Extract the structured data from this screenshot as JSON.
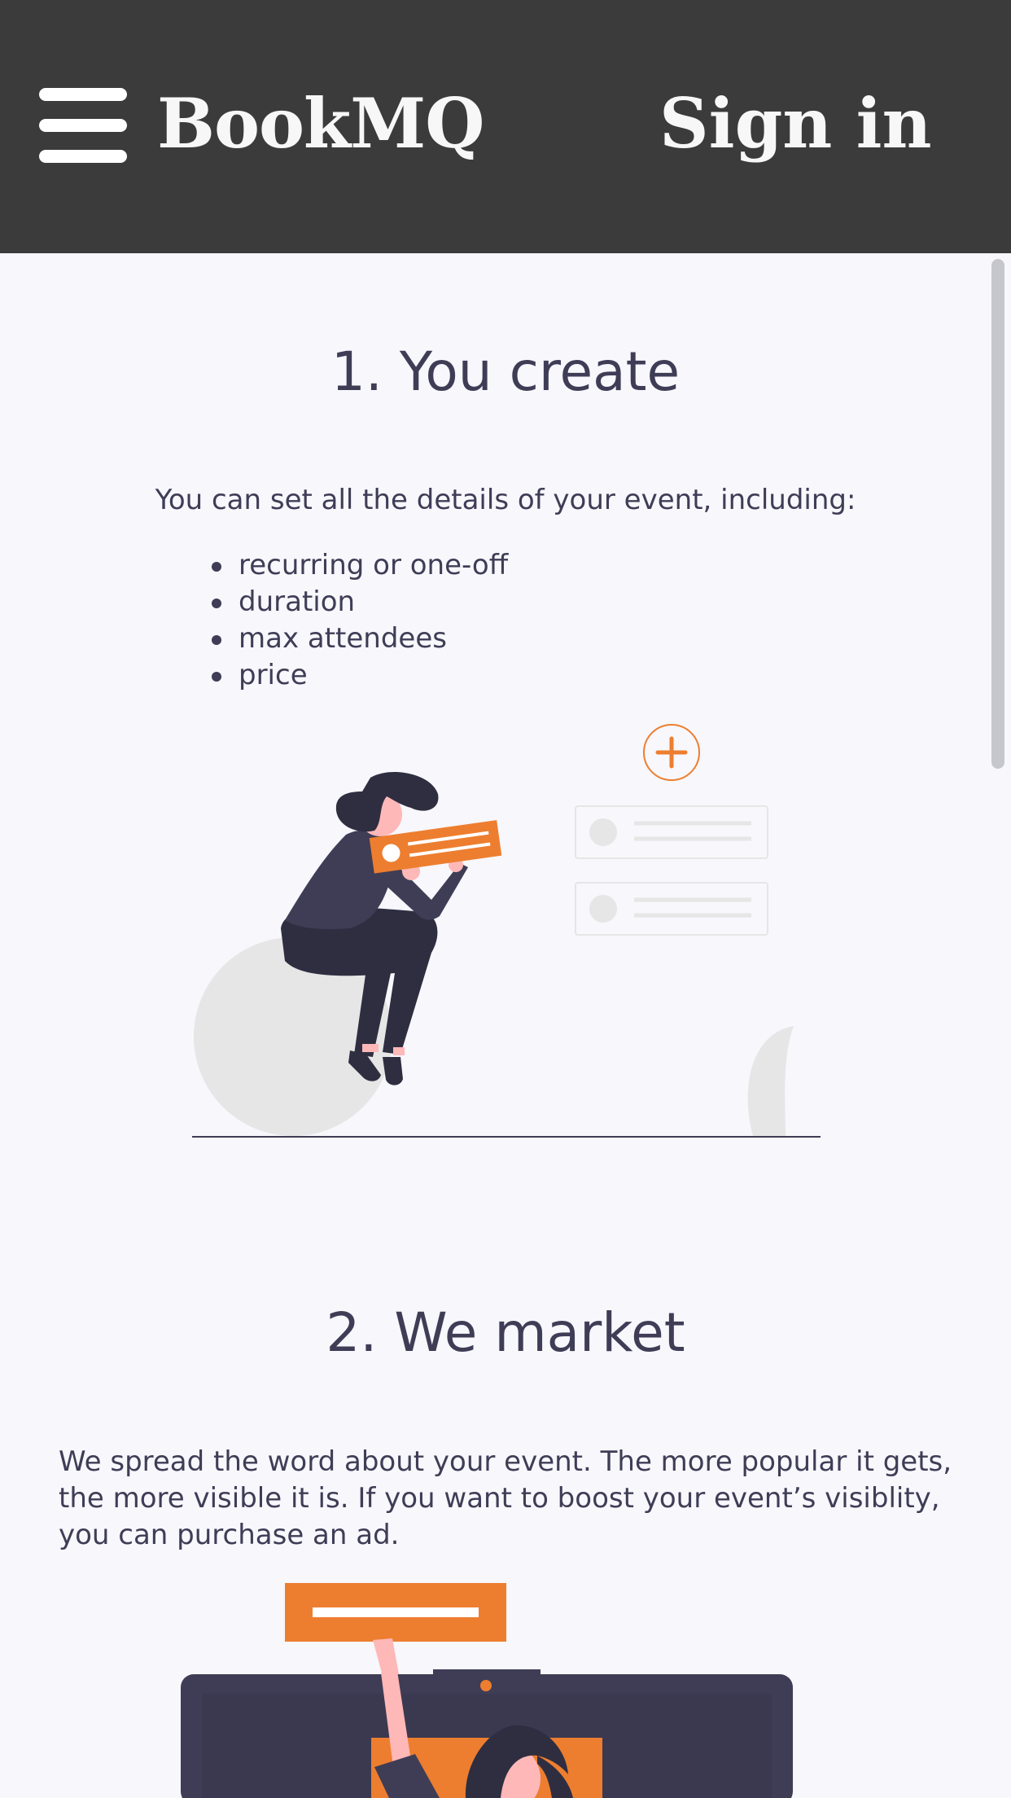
{
  "header": {
    "brand": "BookMQ",
    "signin_label": "Sign in"
  },
  "step1": {
    "title": "1. You create",
    "intro": "You can set all the details of your event, including:",
    "features": [
      "recurring or one-off",
      "duration",
      "max attendees",
      "price"
    ]
  },
  "step2": {
    "title": "2. We market",
    "body": "We spread the word about your event. The more popular it gets, the more visible it is. If you want to boost your event’s visiblity, you can purchase an ad."
  },
  "icons": {
    "menu": "hamburger-menu-icon",
    "add": "plus-circle-icon"
  },
  "colors": {
    "header_bg": "#3b3b3b",
    "accent": "#ed7e2f",
    "text": "#3f3d56",
    "page_bg": "#f7f7fc"
  }
}
